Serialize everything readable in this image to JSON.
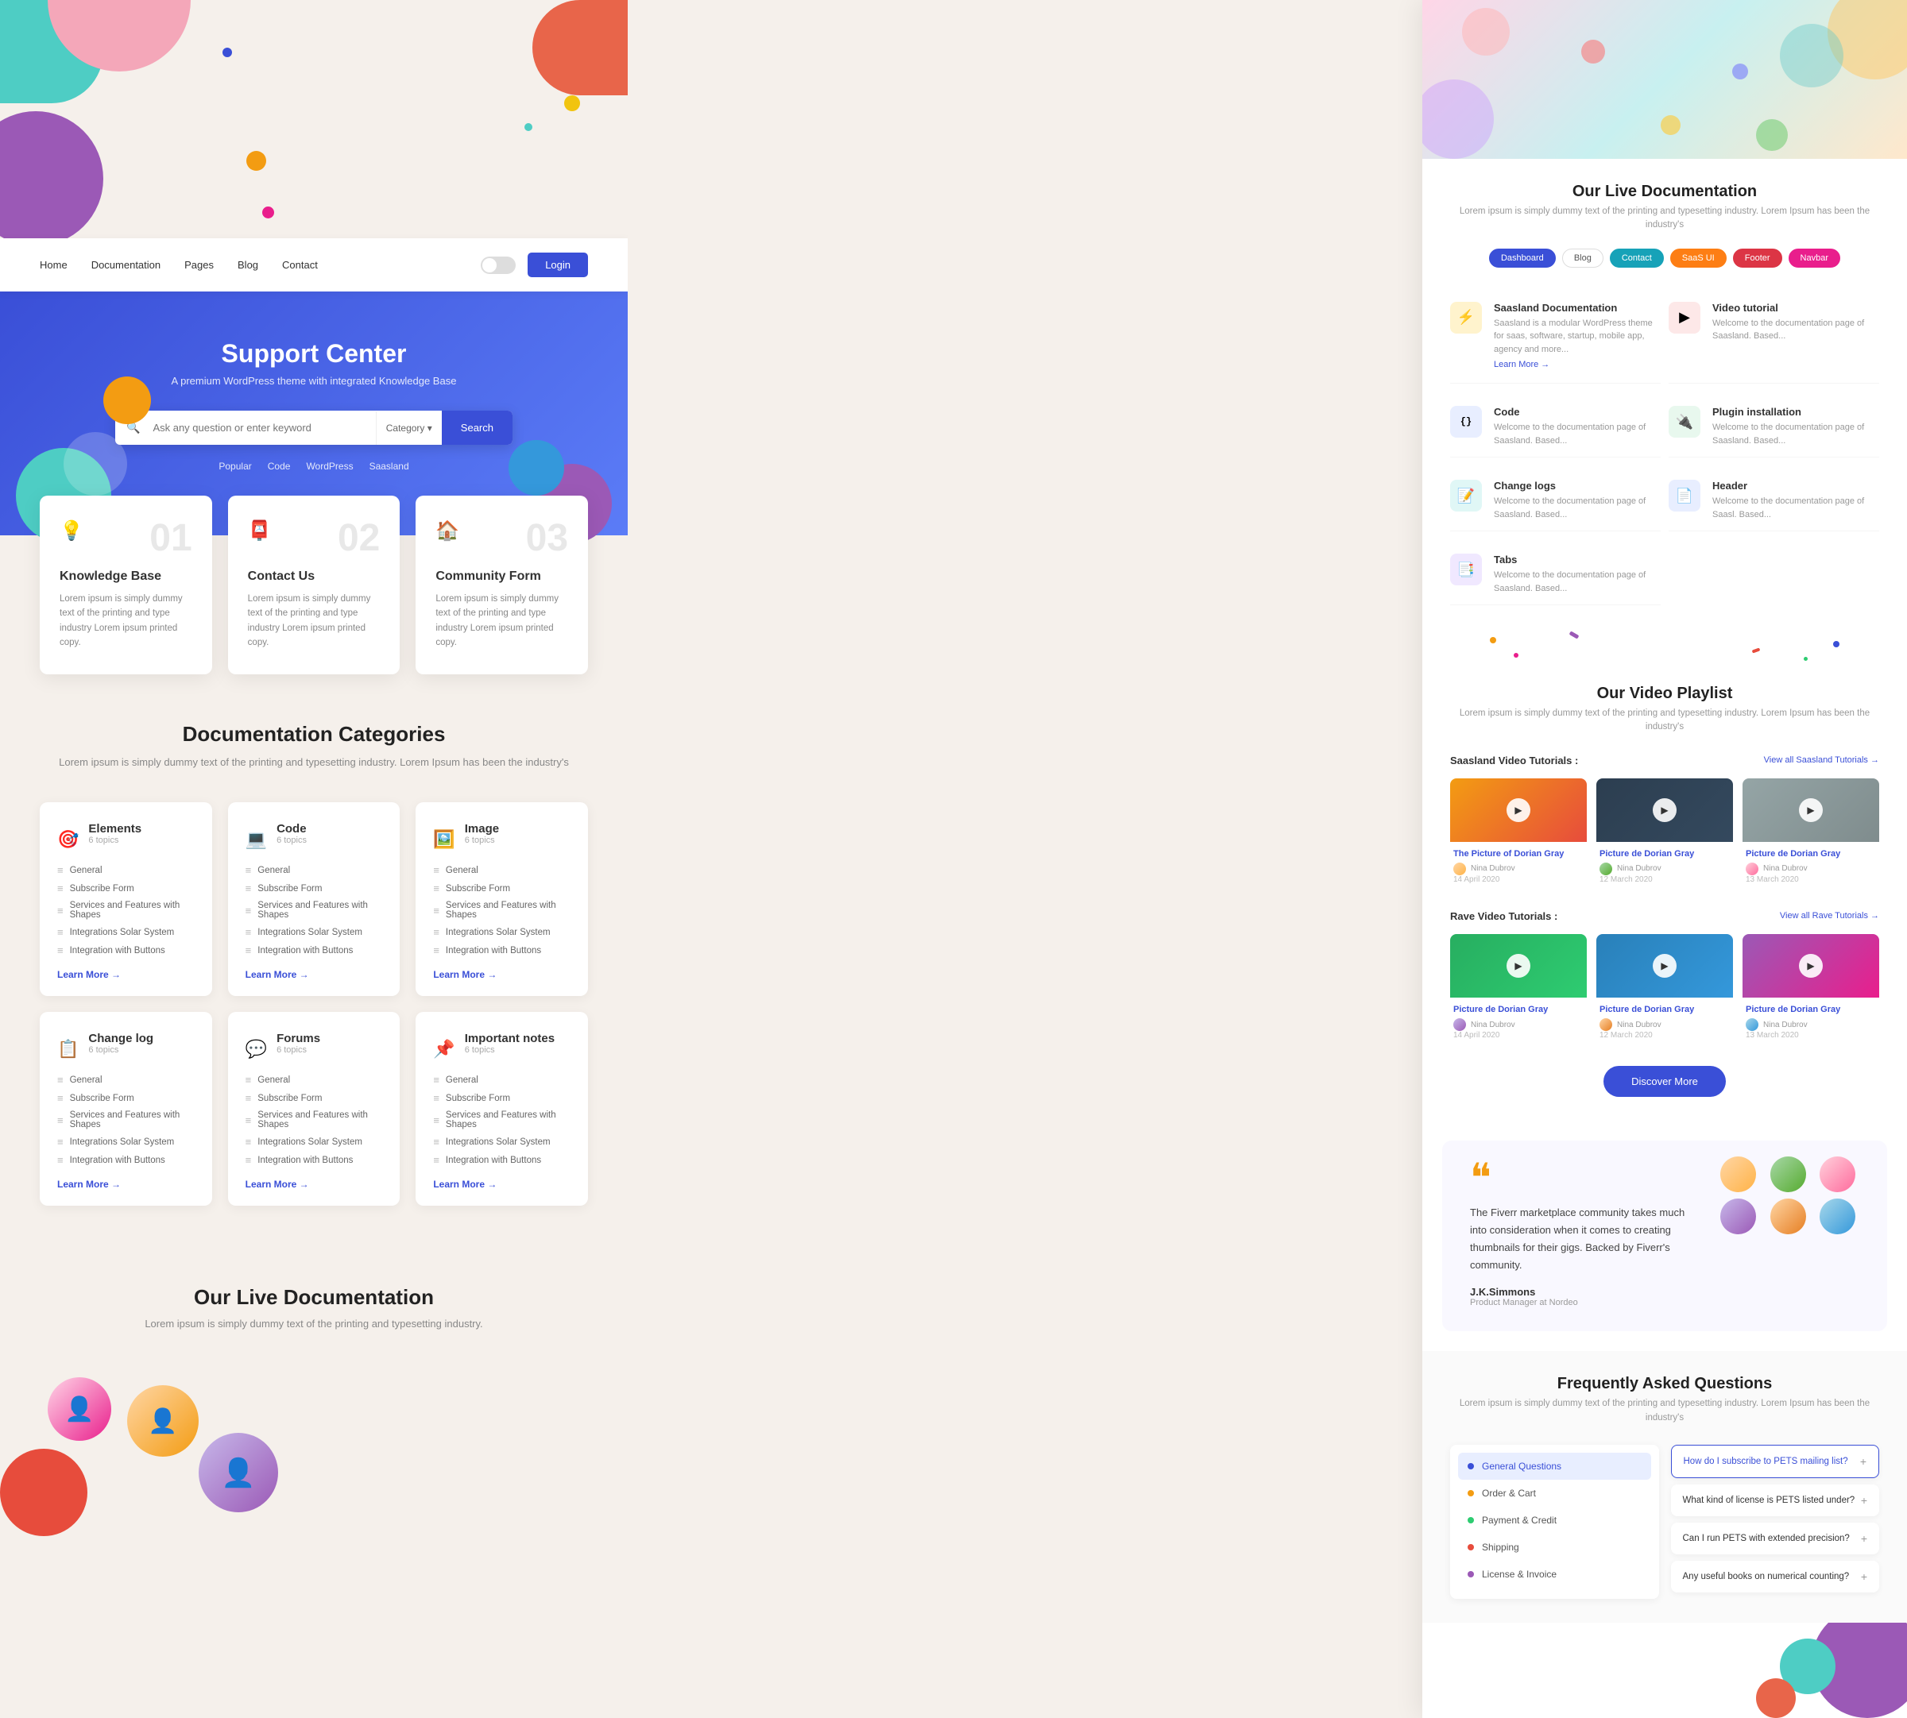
{
  "meta": {
    "title": "Support Center"
  },
  "left": {
    "nav": {
      "links": [
        "Home",
        "Documentation",
        "Pages",
        "Blog",
        "Contact"
      ],
      "login_label": "Login"
    },
    "hero": {
      "title": "Support Center",
      "subtitle": "A premium WordPress theme with integrated Knowledge Base",
      "search_placeholder": "Ask any question or enter keyword",
      "search_category": "Category ▾",
      "search_btn": "Search",
      "tags": [
        "Popular",
        "Code",
        "WordPress",
        "Saasland"
      ]
    },
    "feature_cards": [
      {
        "num": "01",
        "icon": "💡",
        "title": "Knowledge Base",
        "text": "Lorem ipsum is simply dummy text of the printing and type industry Lorem ipsum printed copy."
      },
      {
        "num": "02",
        "icon": "📮",
        "title": "Contact Us",
        "text": "Lorem ipsum is simply dummy text of the printing and type industry Lorem ipsum printed copy."
      },
      {
        "num": "03",
        "icon": "🏠",
        "title": "Community Form",
        "text": "Lorem ipsum is simply dummy text of the printing and type industry Lorem ipsum printed copy."
      }
    ],
    "doc_section": {
      "title": "Documentation Categories",
      "subtitle": "Lorem ipsum is simply dummy text of the printing and typesetting industry. Lorem Ipsum has been the industry's"
    },
    "doc_cards": [
      {
        "icon": "🎯",
        "title": "Elements",
        "topics": "6 topics",
        "items": [
          "General",
          "Subscribe Form",
          "Services and Features with Shapes",
          "Integrations Solar System",
          "Integration with Buttons"
        ],
        "learn": "Learn More →"
      },
      {
        "icon": "💻",
        "title": "Code",
        "topics": "6 topics",
        "items": [
          "General",
          "Subscribe Form",
          "Services and Features with Shapes",
          "Integrations Solar System",
          "Integration with Buttons"
        ],
        "learn": "Learn More →"
      },
      {
        "icon": "🖼️",
        "title": "Image",
        "topics": "6 topics",
        "items": [
          "General",
          "Subscribe Form",
          "Services and Features with Shapes",
          "Integrations Solar System",
          "Integration with Buttons"
        ],
        "learn": "Learn More →"
      },
      {
        "icon": "📋",
        "title": "Change log",
        "topics": "6 topics",
        "items": [
          "General",
          "Subscribe Form",
          "Services and Features with Shapes",
          "Integrations Solar System",
          "Integration with Buttons"
        ],
        "learn": "Learn More →"
      },
      {
        "icon": "💬",
        "title": "Forums",
        "topics": "6 topics",
        "items": [
          "General",
          "Subscribe Form",
          "Services and Features with Shapes",
          "Integrations Solar System",
          "Integration with Buttons"
        ],
        "learn": "Learn More →"
      },
      {
        "icon": "📌",
        "title": "Important notes",
        "topics": "6 topics",
        "items": [
          "General",
          "Subscribe Form",
          "Services and Features with Shapes",
          "Integrations Solar System",
          "Integration with Buttons"
        ],
        "learn": "Learn More →"
      }
    ],
    "live_doc": {
      "title": "Our Live Documentation",
      "subtitle": "Lorem ipsum is simply dummy text of the printing and typesetting industry."
    }
  },
  "right": {
    "live_doc": {
      "title": "Our Live Documentation",
      "subtitle": "Lorem ipsum is simply dummy text of the printing and typesetting industry. Lorem Ipsum has been the industry's",
      "filters": [
        "Dashboard",
        "Blog",
        "Contact",
        "SaaS UI",
        "Footer",
        "Navbar"
      ],
      "items": [
        {
          "icon": "⚡",
          "icon_bg": "yellow",
          "title": "Saasland Documentation",
          "text": "Saasland is a modular WordPress theme for saas, software, startup, mobile app, agency and more...",
          "learn": "Learn More →"
        },
        {
          "icon": "▶️",
          "icon_bg": "red",
          "title": "Video tutorial",
          "text": "Welcome to the documentation page of Saasland. Based..."
        },
        {
          "icon": "{ }",
          "icon_bg": "blue",
          "title": "Code",
          "text": "Welcome to the documentation page of Saasland. Based..."
        },
        {
          "icon": "🔌",
          "icon_bg": "green",
          "title": "Plugin installation",
          "text": "Welcome to the documentation page of Saasland. Based..."
        },
        {
          "icon": "📝",
          "icon_bg": "teal",
          "title": "Change logs",
          "text": "Welcome to the documentation page of Saasland. Based..."
        },
        {
          "icon": "📄",
          "icon_bg": "blue",
          "title": "Header",
          "text": "Welcome to the documentation page of Saasl. Based..."
        },
        {
          "icon": "📑",
          "icon_bg": "purple",
          "title": "Tabs",
          "text": "Welcome to the documentation page of Saasland. Based..."
        }
      ]
    },
    "video": {
      "title": "Our Video Playlist",
      "subtitle": "Lorem ipsum is simply dummy text of the printing and typesetting industry. Lorem Ipsum has been the industry's",
      "saasland_label": "Saasland Video Tutorials :",
      "saasland_view_all": "View all Saasland Tutorials →",
      "rave_label": "Rave Video Tutorials :",
      "rave_view_all": "View all Rave Tutorials →",
      "saasland_videos": [
        {
          "title": "The Picture of Dorian Gray",
          "author": "Nina Dubrov",
          "date": "14 April 2020"
        },
        {
          "title": "Picture de Dorian Gray",
          "author": "Nina Dubrov",
          "date": "12 March 2020"
        },
        {
          "title": "Picture de Dorian Gray",
          "author": "Nina Dubrov",
          "date": "13 March 2020"
        }
      ],
      "rave_videos": [
        {
          "title": "Picture de Dorian Gray",
          "author": "Nina Dubrov",
          "date": "14 April 2020"
        },
        {
          "title": "Picture de Dorian Gray",
          "author": "Nina Dubrov",
          "date": "12 March 2020"
        },
        {
          "title": "Picture de Dorian Gray",
          "author": "Nina Dubrov",
          "date": "13 March 2020"
        }
      ],
      "discover_btn": "Discover More"
    },
    "testimonial": {
      "quote": "The Fiverr marketplace community takes much into consideration when it comes to creating thumbnails for their gigs. Backed by Fiverr's community.",
      "author": "J.K.Simmons",
      "role": "Product Manager at Nordeo"
    },
    "faq": {
      "title": "Frequently Asked Questions",
      "subtitle": "Lorem ipsum is simply dummy text of the printing and typesetting industry. Lorem Ipsum has been the industry's",
      "categories": [
        {
          "label": "General Questions",
          "color": "#3a4fd7",
          "active": true
        },
        {
          "label": "Order & Cart",
          "color": "#f39c12",
          "active": false
        },
        {
          "label": "Payment & Credit",
          "color": "#2ecc71",
          "active": false
        },
        {
          "label": "Shipping",
          "color": "#e74c3c",
          "active": false
        },
        {
          "label": "License & Invoice",
          "color": "#9b59b6",
          "active": false
        }
      ],
      "questions": [
        {
          "text": "How do I subscribe to PETS mailing list?",
          "active": true,
          "icon": "+"
        },
        {
          "text": "What kind of license is PETS listed under?",
          "active": false,
          "icon": "+"
        },
        {
          "text": "Can I run PETS with extended precision?",
          "active": false,
          "icon": "+"
        },
        {
          "text": "Any useful books on numerical counting?",
          "active": false,
          "icon": "+"
        }
      ]
    }
  }
}
